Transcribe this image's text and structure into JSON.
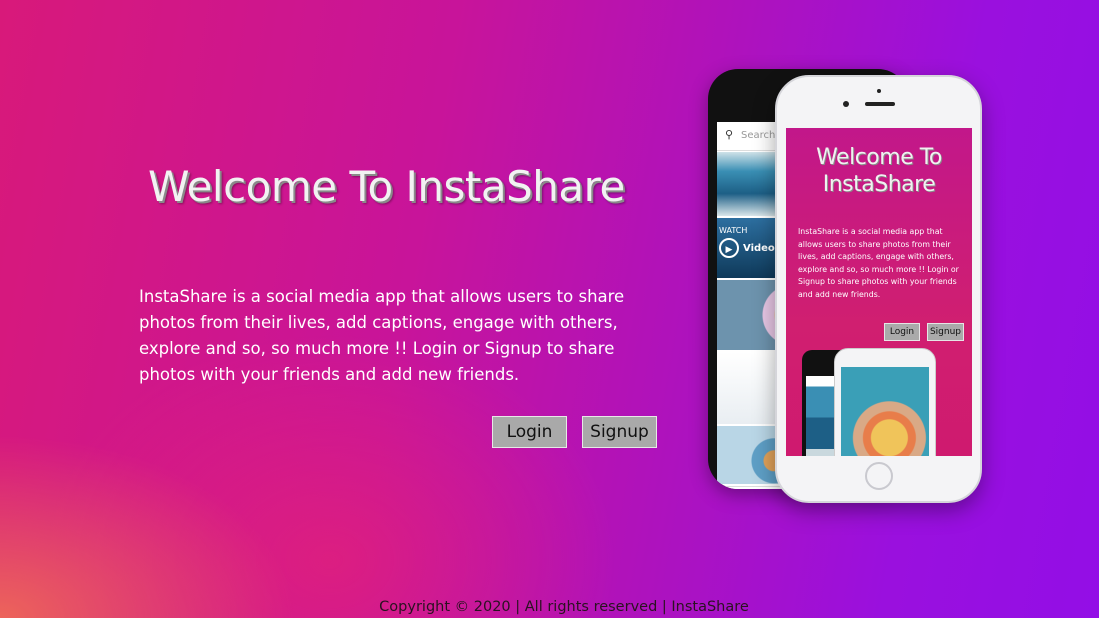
{
  "hero": {
    "title": "Welcome To InstaShare",
    "description": "InstaShare is a social media app that allows users to share photos from their lives, add captions, engage with others, explore and so, so much more !! Login or Signup to share photos with your friends and add new friends.",
    "login_label": "Login",
    "signup_label": "Signup"
  },
  "phone_preview": {
    "back_phone": {
      "search_placeholder": "Search",
      "watch_label": "WATCH",
      "video_label": "Video"
    },
    "front_phone": {
      "title": "Welcome To InstaShare",
      "description": "InstaShare is a social media app that allows users to share photos from their lives, add captions, engage with others, explore and so, so much more !! Login or Signup to share photos with your friends and add new friends.",
      "login_label": "Login",
      "signup_label": "Signup"
    }
  },
  "footer": {
    "text": "Copyright © 2020 | All rights reserved | InstaShare"
  },
  "colors": {
    "background_left": "#d8197a",
    "background_right": "#930ee6",
    "button_bg": "#a9a9a9"
  }
}
